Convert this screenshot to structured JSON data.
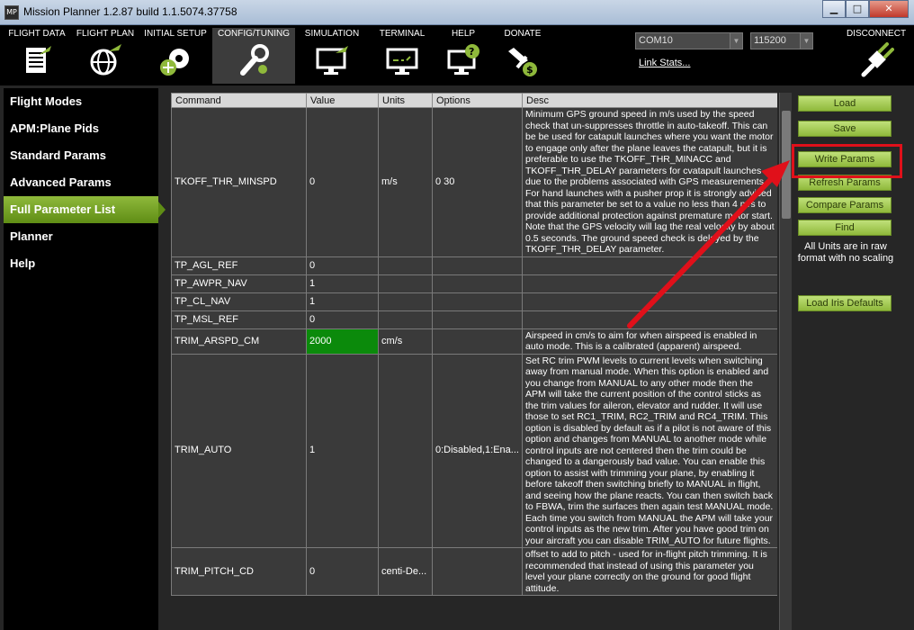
{
  "window": {
    "icon_text": "MP",
    "title": "Mission Planner 1.2.87 build 1.1.5074.37758",
    "minimize": "▁",
    "maximize": "□",
    "close": "✕"
  },
  "toolbar": {
    "items": [
      {
        "label": "FLIGHT DATA",
        "icon": "flight-data-icon"
      },
      {
        "label": "FLIGHT PLAN",
        "icon": "flight-plan-icon"
      },
      {
        "label": "INITIAL SETUP",
        "icon": "initial-setup-icon"
      },
      {
        "label": "CONFIG/TUNING",
        "icon": "config-tuning-icon",
        "active": true
      },
      {
        "label": "SIMULATION",
        "icon": "simulation-icon"
      },
      {
        "label": "TERMINAL",
        "icon": "terminal-icon"
      },
      {
        "label": "HELP",
        "icon": "help-icon"
      },
      {
        "label": "DONATE",
        "icon": "donate-icon"
      }
    ],
    "port": "COM10",
    "baud": "115200",
    "link_stats": "Link Stats...",
    "disconnect": "DISCONNECT"
  },
  "leftnav": {
    "items": [
      {
        "label": "Flight Modes"
      },
      {
        "label": "APM:Plane Pids"
      },
      {
        "label": "Standard Params"
      },
      {
        "label": "Advanced Params"
      },
      {
        "label": "Full Parameter List",
        "active": true
      },
      {
        "label": "Planner"
      },
      {
        "label": "Help"
      }
    ]
  },
  "table": {
    "headers": [
      "Command",
      "Value",
      "Units",
      "Options",
      "Desc"
    ],
    "rows": [
      {
        "command": "TKOFF_THR_MINSPD",
        "value": "0",
        "units": "m/s",
        "options": "0 30",
        "desc": "Minimum GPS ground speed in m/s used by the speed check that un-suppresses throttle in auto-takeoff. This can be be used for catapult launches where you want the motor to engage only after the plane leaves the catapult, but it is preferable to use the TKOFF_THR_MINACC and TKOFF_THR_DELAY parameters for cvatapult launches due to the problems associated with GPS measurements. For hand launches with a pusher prop it is strongly advised that this parameter be set to a value no less than 4 m/s to provide additional protection against premature motor start. Note that the GPS velocity will lag the real velocity by about 0.5 seconds. The ground speed check is delayed by the TKOFF_THR_DELAY parameter."
      },
      {
        "command": "TP_AGL_REF",
        "value": "0",
        "units": "",
        "options": "",
        "desc": ""
      },
      {
        "command": "TP_AWPR_NAV",
        "value": "1",
        "units": "",
        "options": "",
        "desc": ""
      },
      {
        "command": "TP_CL_NAV",
        "value": "1",
        "units": "",
        "options": "",
        "desc": ""
      },
      {
        "command": "TP_MSL_REF",
        "value": "0",
        "units": "",
        "options": "",
        "desc": ""
      },
      {
        "command": "TRIM_ARSPD_CM",
        "value": "2000",
        "units": "cm/s",
        "options": "",
        "highlight": true,
        "desc": "Airspeed in cm/s to aim for when airspeed is enabled in auto mode. This is a calibrated (apparent) airspeed."
      },
      {
        "command": "TRIM_AUTO",
        "value": "1",
        "units": "",
        "options": "0:Disabled,1:Ena...",
        "desc": "Set RC trim PWM levels to current levels when switching away from manual mode. When this option is enabled and you change from MANUAL to any other mode then the APM will take the current position of the control sticks as the trim values for aileron, elevator and rudder. It will use those to set RC1_TRIM, RC2_TRIM and RC4_TRIM. This option is disabled by default as if a pilot is not aware of this option and changes from MANUAL to another mode while control inputs are not centered then the trim could be changed to a dangerously bad value. You can enable this option to assist with trimming your plane, by enabling it before takeoff then switching briefly to MANUAL in flight, and seeing how the plane reacts. You can then switch back to FBWA, trim the surfaces then again test MANUAL mode. Each time you switch from MANUAL the APM will take your control inputs as the new trim. After you have good trim on your aircraft you can disable TRIM_AUTO for future flights."
      },
      {
        "command": "TRIM_PITCH_CD",
        "value": "0",
        "units": "centi-De...",
        "options": "",
        "desc": "offset to add to pitch - used for in-flight pitch trimming. It is recommended that instead of using this parameter you level your plane correctly on the ground for good flight attitude."
      }
    ]
  },
  "rightpanel": {
    "load": "Load",
    "save": "Save",
    "write": "Write Params",
    "refresh": "Refresh Params",
    "compare": "Compare Params",
    "find": "Find",
    "note": "All Units are in raw format with no scaling",
    "load_defaults": "Load Iris Defaults"
  },
  "colors": {
    "accent_green": "#8fb93b",
    "highlight_red": "#e0101a",
    "value_green": "#0b8a0b"
  }
}
